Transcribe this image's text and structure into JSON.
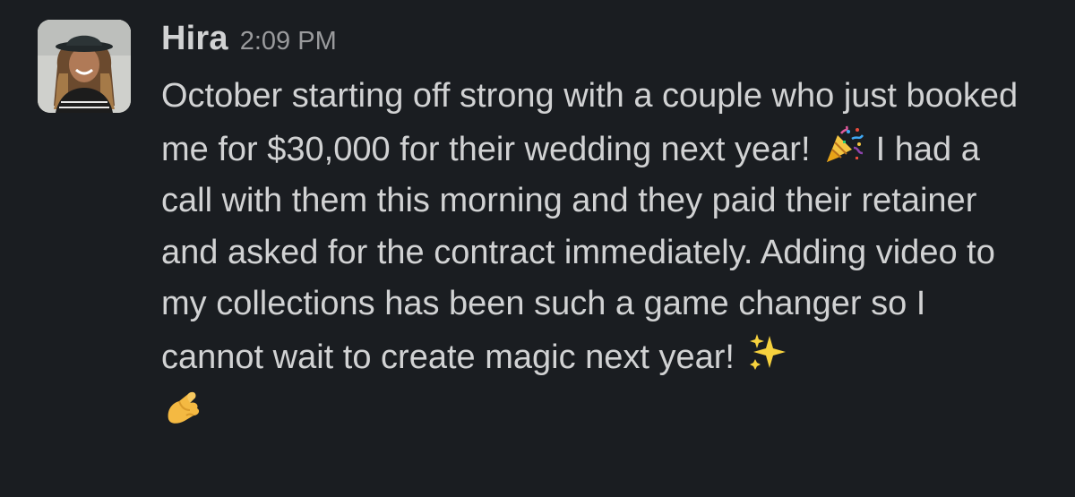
{
  "message": {
    "sender": "Hira",
    "timestamp": "2:09 PM",
    "avatar": "user-avatar-hira",
    "text_parts": [
      "October starting off strong with a couple who just booked me for $30,000 for their wedding next year!",
      "I had a call with them this morning and they paid their retainer and asked for the contract immediately. Adding video to my collections has been such a game changer so I cannot wait to create magic next year!"
    ],
    "emojis": [
      "party-popper-icon",
      "sparkles-icon",
      "pinching-hand-icon"
    ]
  },
  "colors": {
    "background": "#1a1d21",
    "text": "#d1d2d3",
    "timestamp": "#9a9b9d"
  }
}
